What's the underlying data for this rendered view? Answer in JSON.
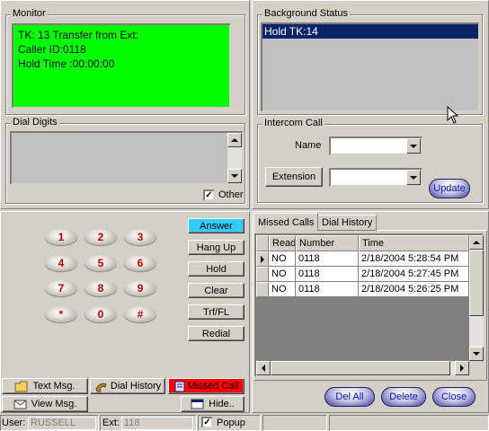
{
  "monitor": {
    "title": "Monitor",
    "lines": [
      "TK: 13 Transfer from Ext:",
      "Caller ID:0118",
      "Hold Time :00:00:00"
    ],
    "bg_color": "#00ff00"
  },
  "dial_digits": {
    "title": "Dial Digits",
    "other_label": "Other",
    "other_checked": true
  },
  "background_status": {
    "title": "Background Status",
    "items": [
      "Hold TK:14"
    ],
    "selected_color": "#0a246a"
  },
  "intercom": {
    "title": "Intercom Call",
    "name_label": "Name",
    "extension_label": "Extension",
    "update_label": "Update"
  },
  "dialpad": {
    "keys": [
      "1",
      "2",
      "3",
      "4",
      "5",
      "6",
      "7",
      "8",
      "9",
      "*",
      "0",
      "#"
    ]
  },
  "actions": {
    "answer": "Answer",
    "hangup": "Hang Up",
    "hold": "Hold",
    "clear": "Clear",
    "transfer": "Trf/FL",
    "redial": "Redial",
    "answer_color": "#33ccff"
  },
  "bottom_buttons": {
    "text_msg": "Text Msg.",
    "dial_history": "Dial History",
    "missed_call": "Missed Call",
    "view_msg": "View Msg.",
    "hide": "Hide..",
    "missed_color": "#ff0000"
  },
  "tabs": [
    "Missed Calls",
    "Dial History"
  ],
  "missed_calls": {
    "columns": [
      "Read",
      "Number",
      "Time"
    ],
    "rows": [
      {
        "read": "NO",
        "number": "0118",
        "time": "2/18/2004 5:28:54 PM"
      },
      {
        "read": "NO",
        "number": "0118",
        "time": "2/18/2004 5:27:45 PM"
      },
      {
        "read": "NO",
        "number": "0118",
        "time": "2/18/2004 5:26:25 PM"
      }
    ]
  },
  "list_actions": {
    "del_all": "Del All",
    "delete": "Delete",
    "close": "Close"
  },
  "status_bar": {
    "user_label": "User:",
    "user_value": "RUSSELL",
    "ext_label": "Ext:",
    "ext_value": "118",
    "popup_label": "Popup",
    "popup_checked": true
  }
}
